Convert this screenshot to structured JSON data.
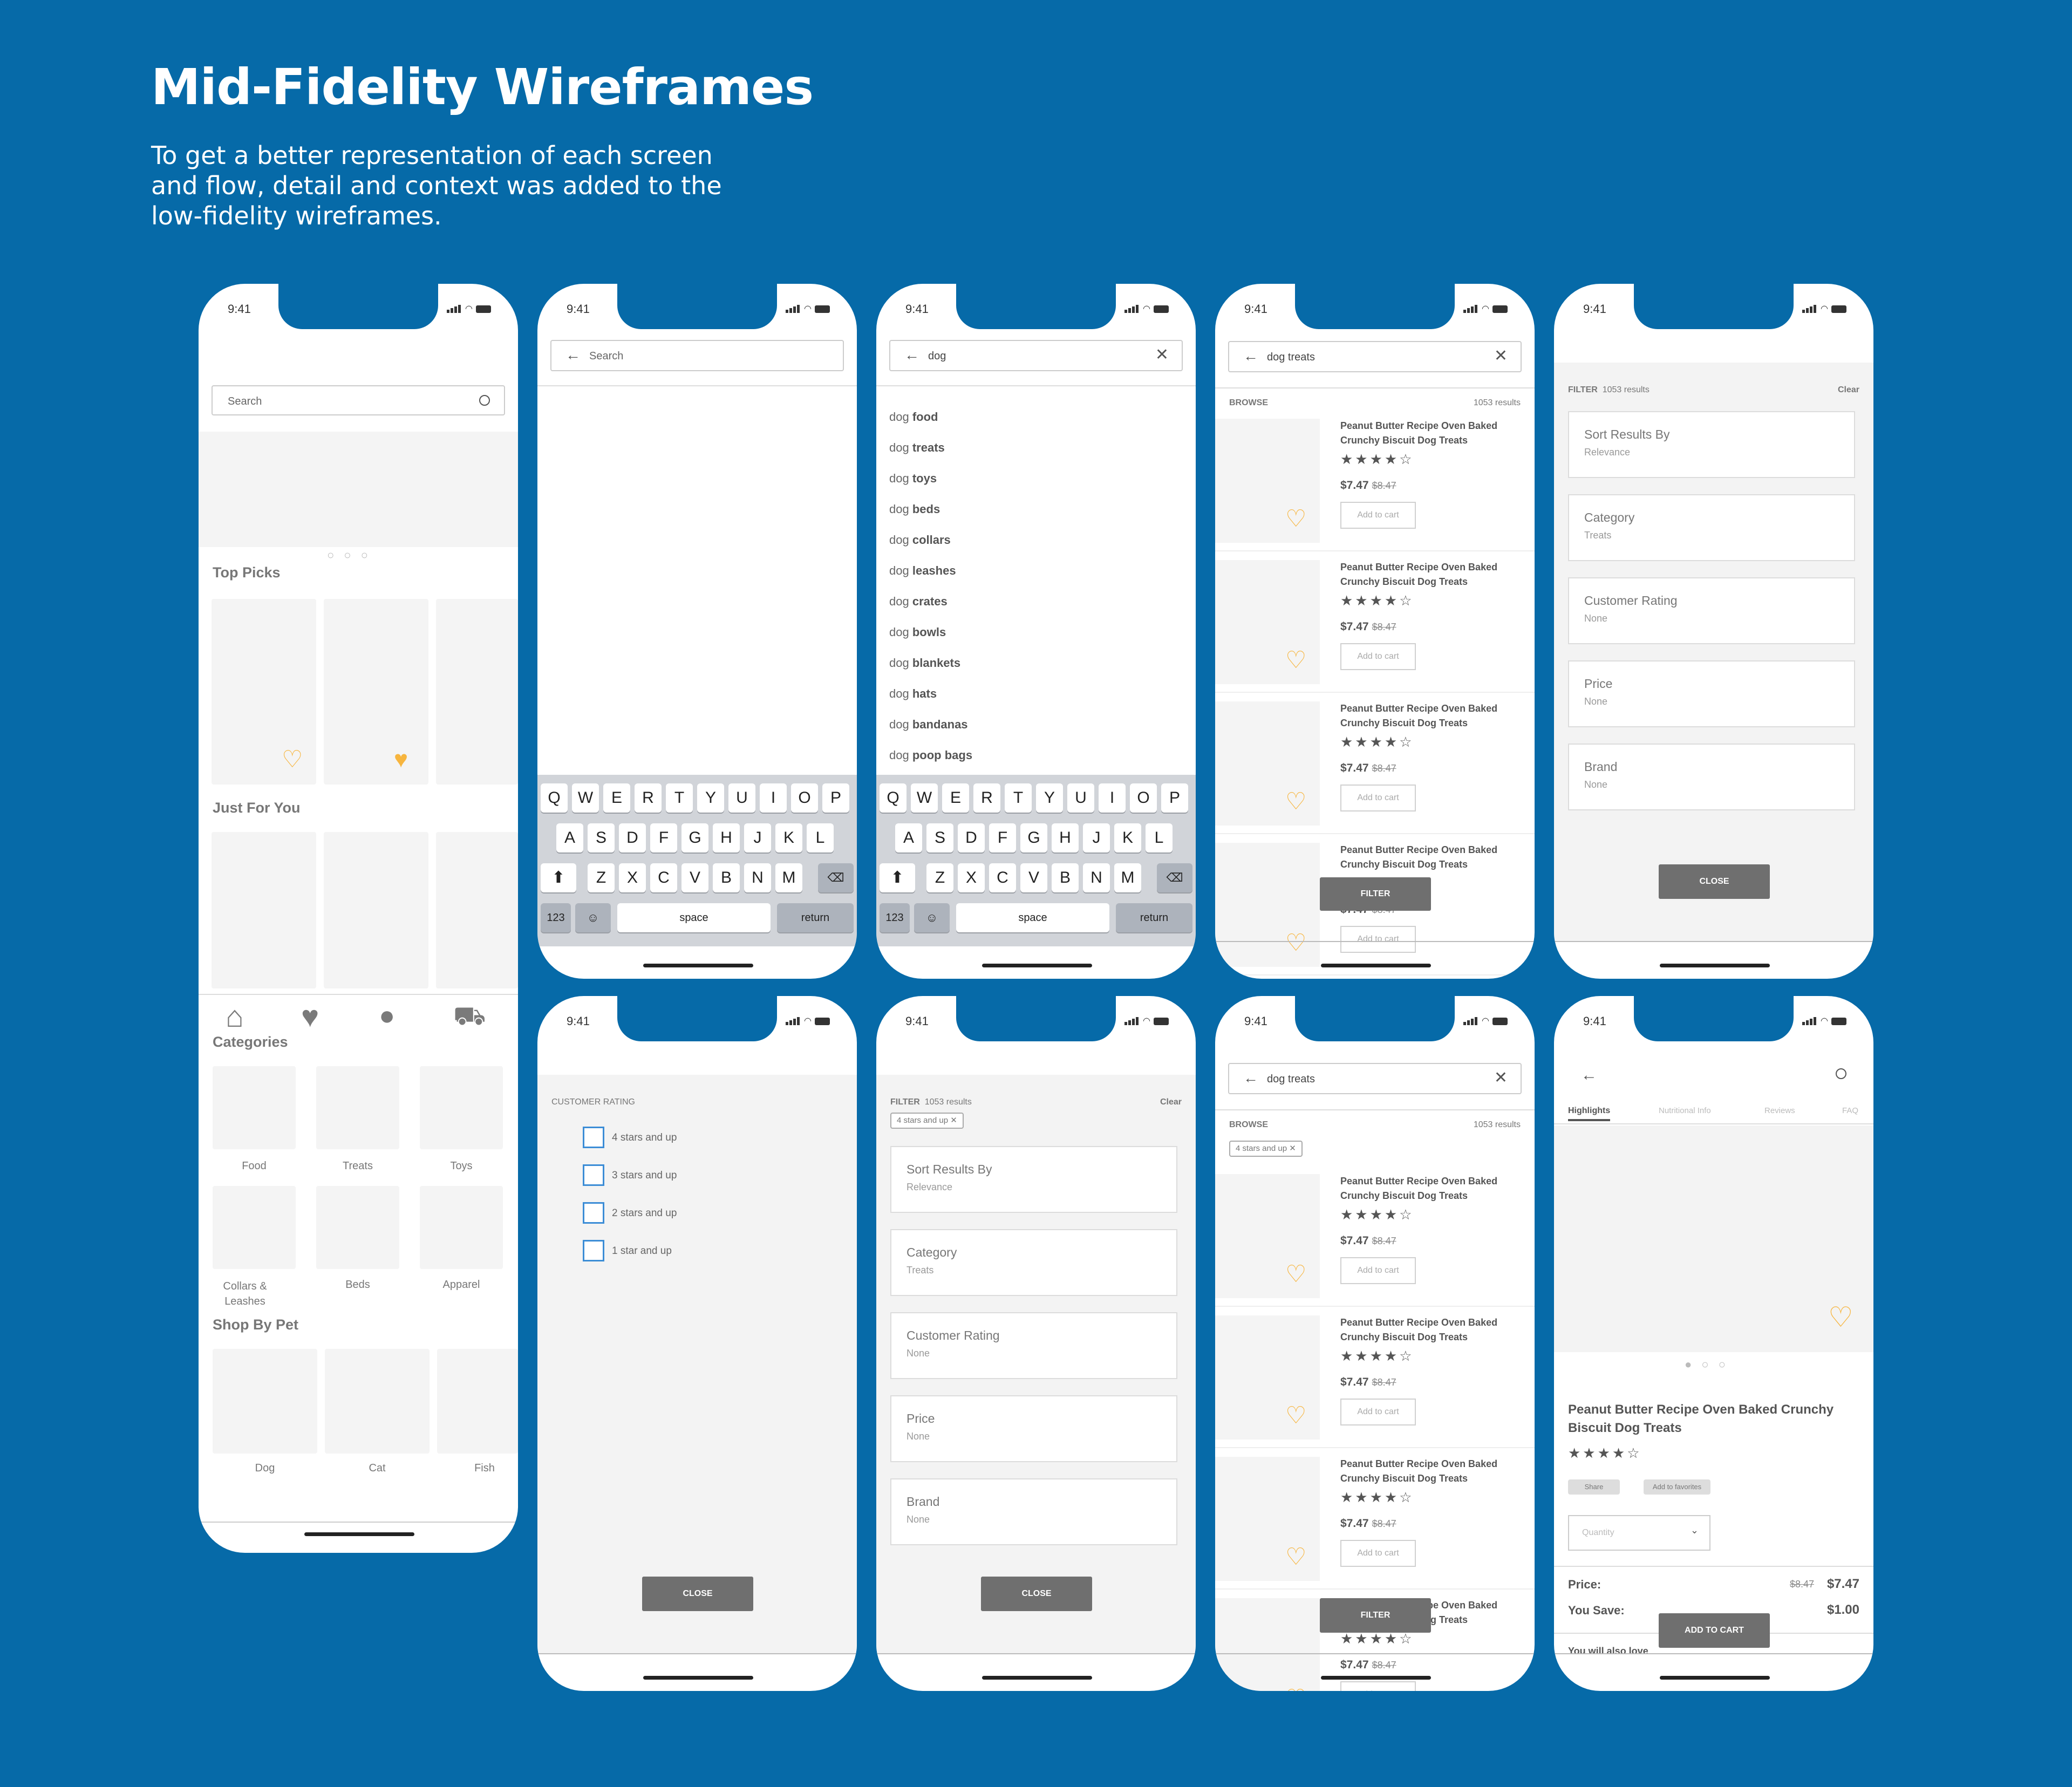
{
  "header": {
    "title": "Mid-Fidelity Wireframes",
    "description": "To get a better representation of each screen and flow, detail and context was added to the low-fidelity wireframes."
  },
  "status": {
    "time": "9:41"
  },
  "colors": {
    "background": "#066aa8",
    "heart": "#f7b53e",
    "checkbox": "#3c8dd6"
  },
  "home": {
    "search_placeholder": "Search",
    "top_picks": "Top Picks",
    "just_for_you": "Just For You",
    "categories_label": "Categories",
    "categories": [
      "Food",
      "Treats",
      "Toys",
      "Collars & Leashes",
      "Beds",
      "Apparel"
    ],
    "shop_by_pet": "Shop By Pet",
    "pets": [
      "Dog",
      "Cat",
      "Fish"
    ],
    "nav_icons": [
      "home-icon",
      "heart-icon",
      "user-icon",
      "cart-icon"
    ]
  },
  "search": {
    "placeholder": "Search"
  },
  "keyboard": {
    "row1": [
      "Q",
      "W",
      "E",
      "R",
      "T",
      "Y",
      "U",
      "I",
      "O",
      "P"
    ],
    "row2": [
      "A",
      "S",
      "D",
      "F",
      "G",
      "H",
      "J",
      "K",
      "L"
    ],
    "row3": [
      "Z",
      "X",
      "C",
      "V",
      "B",
      "N",
      "M"
    ],
    "numbers": "123",
    "space": "space",
    "return": "return"
  },
  "typing": {
    "query": "dog",
    "prefix": "dog",
    "suggestions": [
      "food",
      "treats",
      "toys",
      "beds",
      "collars",
      "leashes",
      "crates",
      "bowls",
      "blankets",
      "hats",
      "bandanas",
      "poop bags"
    ]
  },
  "results": {
    "query": "dog treats",
    "browse": "BROWSE",
    "count": "1053 results",
    "product_name": "Peanut Butter Recipe Oven Baked Crunchy Biscuit Dog Treats",
    "price": "$7.47",
    "old_price": "$8.47",
    "add_to_cart": "Add to cart",
    "filter_button": "FILTER",
    "rating": 4
  },
  "filter": {
    "title": "FILTER",
    "count": "1053 results",
    "clear": "Clear",
    "items": [
      {
        "title": "Sort Results By",
        "value": "Relevance"
      },
      {
        "title": "Category",
        "value": "Treats"
      },
      {
        "title": "Customer Rating",
        "value": "None"
      },
      {
        "title": "Price",
        "value": "None"
      },
      {
        "title": "Brand",
        "value": "None"
      }
    ],
    "close": "CLOSE",
    "chip": "4 stars and up"
  },
  "rating_filter": {
    "title": "CUSTOMER RATING",
    "options": [
      "4 stars and up",
      "3 stars and up",
      "2 stars and up",
      "1 star and up"
    ],
    "close": "CLOSE"
  },
  "detail": {
    "tabs": [
      "Highlights",
      "Nutritional Info",
      "Reviews",
      "FAQ"
    ],
    "name": "Peanut Butter Recipe Oven Baked Crunchy Biscuit Dog Treats",
    "share": "Share",
    "add_fav": "Add to favorites",
    "quantity": "Quantity",
    "price_label": "Price:",
    "old_price": "$8.47",
    "price": "$7.47",
    "save_label": "You Save:",
    "save": "$1.00",
    "add_to_cart": "ADD TO CART",
    "also_like": "You will also love"
  }
}
